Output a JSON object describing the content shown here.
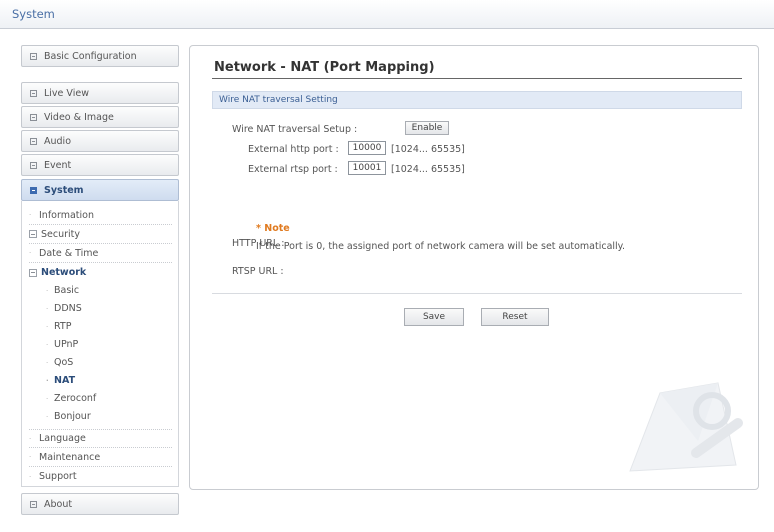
{
  "header": {
    "title": "System"
  },
  "sidebar": {
    "main_items": [
      {
        "label": "Basic Configuration"
      },
      {
        "label": "Live View"
      },
      {
        "label": "Video & Image"
      },
      {
        "label": "Audio"
      },
      {
        "label": "Event"
      },
      {
        "label": "System"
      }
    ],
    "system_sub": {
      "information": "Information",
      "security": "Security",
      "date_time": "Date & Time",
      "network": "Network",
      "network_items": [
        "Basic",
        "DDNS",
        "RTP",
        "UPnP",
        "QoS",
        "NAT",
        "Zeroconf",
        "Bonjour"
      ],
      "language": "Language",
      "maintenance": "Maintenance",
      "support": "Support"
    },
    "about": "About"
  },
  "main": {
    "title": "Network - NAT (Port Mapping)",
    "section": "Wire NAT traversal Setting",
    "setup_label": "Wire NAT traversal Setup :",
    "enable_button": "Enable",
    "http_port_label": "External http port :",
    "http_port_value": "10000",
    "http_port_range": "[1024... 65535]",
    "rtsp_port_label": "External rtsp port :",
    "rtsp_port_value": "10001",
    "rtsp_port_range": "[1024... 65535]",
    "note_title": "* Note",
    "note_text": "If the Port is 0, the assigned port of network camera will be set automatically.",
    "http_url_label": "HTTP URL :",
    "rtsp_url_label": "RTSP URL :",
    "save_button": "Save",
    "reset_button": "Reset"
  },
  "colors": {
    "accent": "#2c4d7a",
    "note": "#e07a1f",
    "section_bg": "#e2eaf6"
  }
}
